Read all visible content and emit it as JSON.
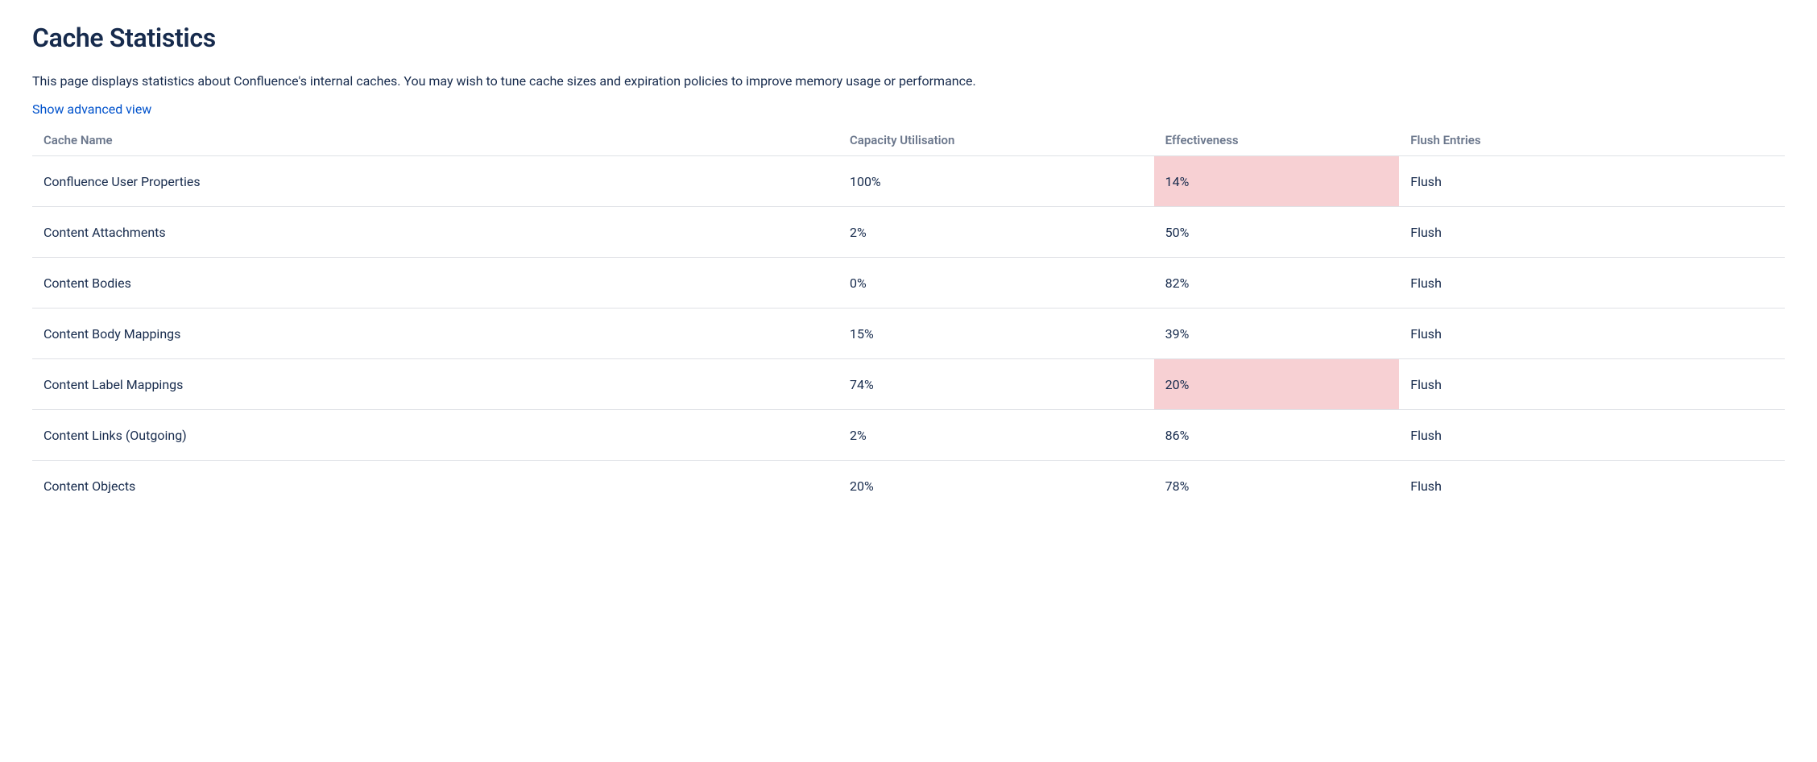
{
  "page": {
    "title": "Cache Statistics",
    "description": "This page displays statistics about Confluence's internal caches. You may wish to tune cache sizes and expiration policies to improve memory usage or performance.",
    "advancedViewLabel": "Show advanced view"
  },
  "table": {
    "headers": {
      "cacheName": "Cache Name",
      "capacity": "Capacity Utilisation",
      "effectiveness": "Effectiveness",
      "flushEntries": "Flush Entries"
    },
    "rows": [
      {
        "name": "Confluence User Properties",
        "capacity": "100%",
        "effectiveness": "14%",
        "highlight": true,
        "flushLabel": "Flush"
      },
      {
        "name": "Content Attachments",
        "capacity": "2%",
        "effectiveness": "50%",
        "highlight": false,
        "flushLabel": "Flush"
      },
      {
        "name": "Content Bodies",
        "capacity": "0%",
        "effectiveness": "82%",
        "highlight": false,
        "flushLabel": "Flush"
      },
      {
        "name": "Content Body Mappings",
        "capacity": "15%",
        "effectiveness": "39%",
        "highlight": false,
        "flushLabel": "Flush"
      },
      {
        "name": "Content Label Mappings",
        "capacity": "74%",
        "effectiveness": "20%",
        "highlight": true,
        "flushLabel": "Flush"
      },
      {
        "name": "Content Links (Outgoing)",
        "capacity": "2%",
        "effectiveness": "86%",
        "highlight": false,
        "flushLabel": "Flush"
      },
      {
        "name": "Content Objects",
        "capacity": "20%",
        "effectiveness": "78%",
        "highlight": false,
        "flushLabel": "Flush"
      }
    ]
  }
}
